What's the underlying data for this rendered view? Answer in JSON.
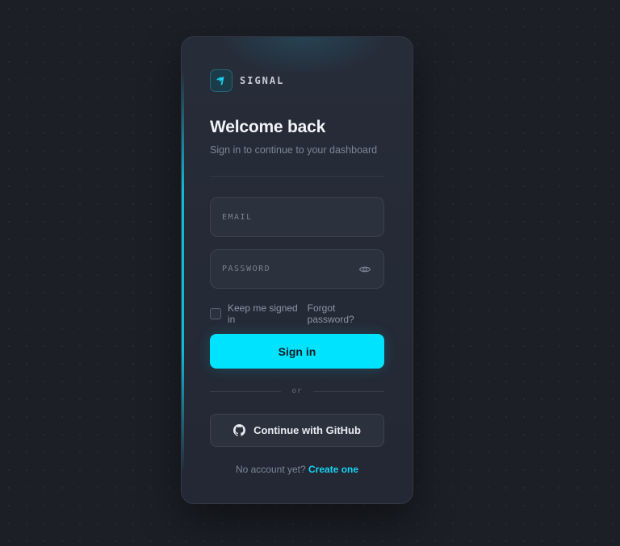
{
  "brand": {
    "name": "SIGNAL",
    "logo_icon": "signal-bolt-icon"
  },
  "header": {
    "title": "Welcome back",
    "subtitle": "Sign in to continue to your dashboard"
  },
  "form": {
    "email": {
      "placeholder": "EMAIL",
      "value": ""
    },
    "password": {
      "placeholder": "PASSWORD",
      "value": "",
      "toggle_icon": "eye-icon"
    },
    "remember_label": "Keep me signed in",
    "remember_checked": false,
    "forgot_label": "Forgot password?",
    "submit_label": "Sign in"
  },
  "divider_text": "or",
  "oauth": {
    "github_label": "Continue with GitHub",
    "github_icon": "github-icon"
  },
  "footer": {
    "prompt": "No account yet?",
    "link_label": "Create one"
  },
  "colors": {
    "accent": "#00e3ff",
    "background": "#1c1f26",
    "card": "#262c38"
  }
}
